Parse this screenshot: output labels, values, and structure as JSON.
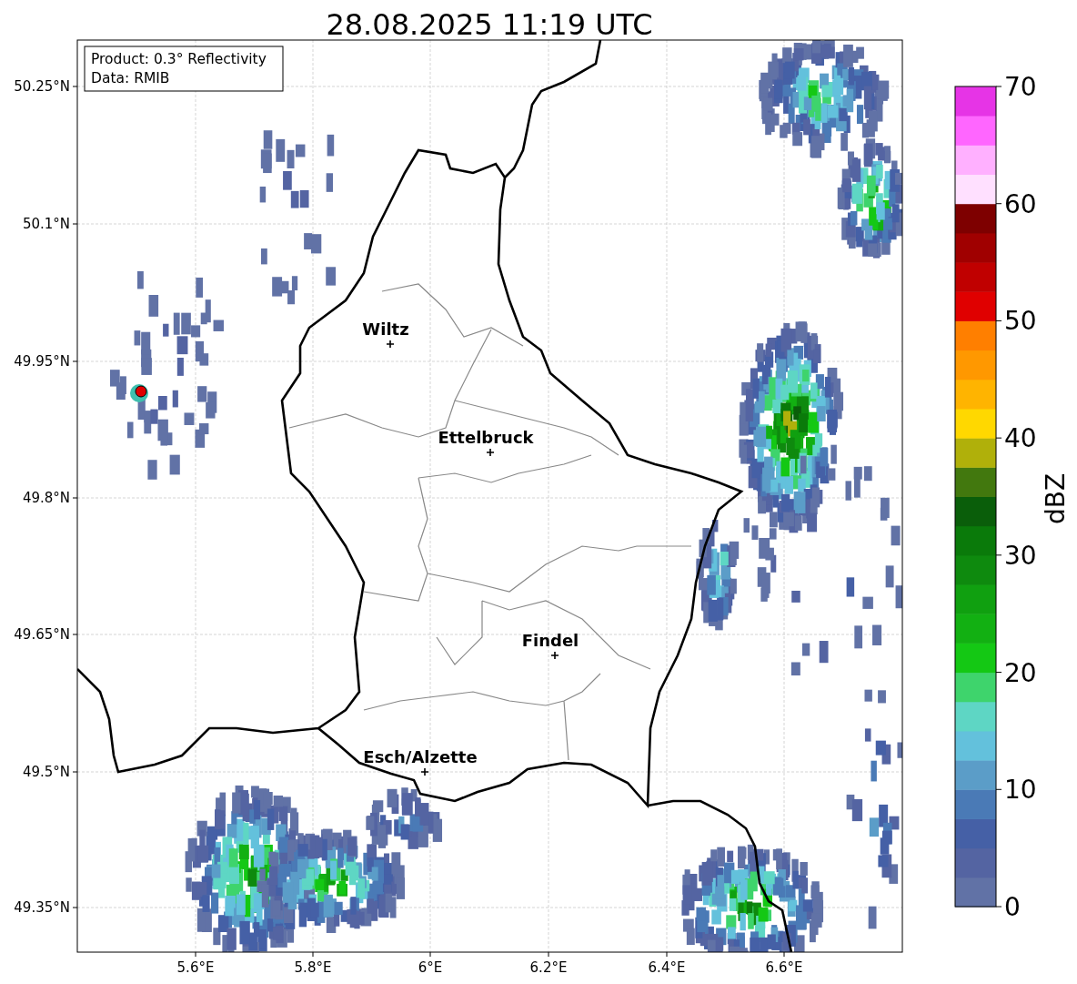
{
  "title": "28.08.2025 11:19 UTC",
  "info_box": [
    "Product: 0.3° Reflectivity",
    "Data: RMIB"
  ],
  "cities": [
    {
      "name": "Wiltz"
    },
    {
      "name": "Ettelbruck"
    },
    {
      "name": "Findel"
    },
    {
      "name": "Esch/Alzette"
    }
  ],
  "lat_ticks": [
    "50.25°N",
    "50.1°N",
    "49.95°N",
    "49.8°N",
    "49.65°N",
    "49.5°N",
    "49.35°N"
  ],
  "lon_ticks": [
    "5.6°E",
    "5.8°E",
    "6°E",
    "6.2°E",
    "6.4°E",
    "6.6°E"
  ],
  "colorbar": {
    "label": "dBZ",
    "ticks": [
      "70",
      "60",
      "50",
      "40",
      "30",
      "20",
      "10",
      "0"
    ],
    "bands": [
      {
        "color": "#6172a6"
      },
      {
        "color": "#5464a2"
      },
      {
        "color": "#4560a6"
      },
      {
        "color": "#4a7ab6"
      },
      {
        "color": "#5b9dc8"
      },
      {
        "color": "#63c1dc"
      },
      {
        "color": "#5ed6c4"
      },
      {
        "color": "#3ed46c"
      },
      {
        "color": "#14c814"
      },
      {
        "color": "#12b012"
      },
      {
        "color": "#10a010"
      },
      {
        "color": "#0e8a0e"
      },
      {
        "color": "#0a7a0a"
      },
      {
        "color": "#0a5e0a"
      },
      {
        "color": "#42780e"
      },
      {
        "color": "#b0b00a"
      },
      {
        "color": "#ffd800"
      },
      {
        "color": "#ffb400"
      },
      {
        "color": "#ff9800"
      },
      {
        "color": "#ff7f00"
      },
      {
        "color": "#e00000"
      },
      {
        "color": "#c00000"
      },
      {
        "color": "#a00000"
      },
      {
        "color": "#7e0000"
      },
      {
        "color": "#ffe0ff"
      },
      {
        "color": "#ffb0ff"
      },
      {
        "color": "#ff66ff"
      },
      {
        "color": "#e634e6"
      }
    ]
  }
}
